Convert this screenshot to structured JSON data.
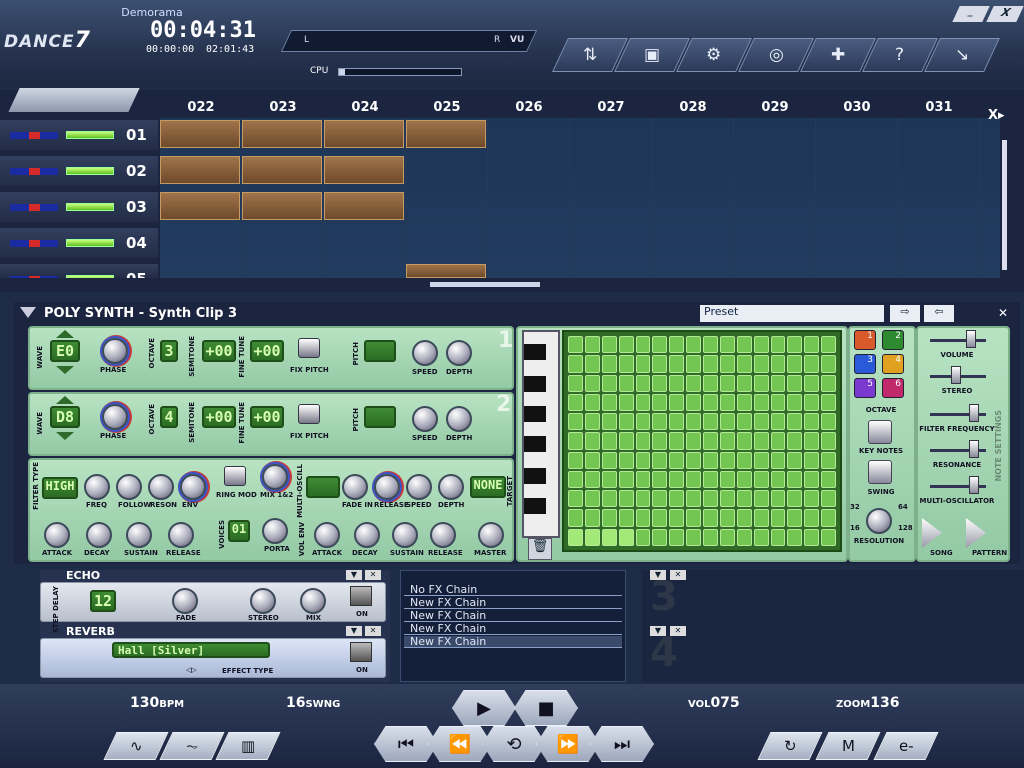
{
  "app": {
    "brand": "DANCE",
    "brand_num": "7",
    "song_name": "Demorama"
  },
  "time": {
    "main": "00:04:31",
    "elapsed": "00:00:00",
    "total": "02:01:43"
  },
  "vu": {
    "left_label": "L",
    "right_label": "R",
    "vu_label": "VU"
  },
  "cpu": {
    "label": "CPU",
    "level": 0.05
  },
  "toolbar_icons": [
    "shuffle-icon",
    "folder-icon",
    "mixer-icon",
    "record-icon",
    "puzzle-icon",
    "help-icon",
    "exit-icon"
  ],
  "toolbar_glyphs": [
    "⇅",
    "▣",
    "⚙",
    "◎",
    "✚",
    "?",
    "↘"
  ],
  "window": {
    "min": "_",
    "close": "X"
  },
  "arrangement": {
    "bars": [
      "022",
      "023",
      "024",
      "025",
      "026",
      "027",
      "028",
      "029",
      "030",
      "031"
    ],
    "tracks": [
      {
        "num": "01",
        "clips": [
          0,
          1,
          2,
          3
        ]
      },
      {
        "num": "02",
        "clips": [
          0,
          1,
          2
        ]
      },
      {
        "num": "03",
        "clips": [
          0,
          1,
          2
        ]
      },
      {
        "num": "04",
        "clips": []
      },
      {
        "num": "05",
        "clips": [
          3
        ]
      }
    ]
  },
  "synth": {
    "title": "POLY SYNTH - Synth Clip 3",
    "preset": "Preset",
    "osc1": {
      "wave": "E0",
      "octave": "3",
      "semitone": "+00",
      "fine_tune": "+00"
    },
    "osc2": {
      "wave": "D8",
      "octave": "4",
      "semitone": "+00",
      "fine_tune": "+00"
    },
    "filter": {
      "type": "HIGH"
    },
    "voices": "01",
    "multi_osc": "NONE",
    "labels": {
      "wave": "WAVE",
      "phase": "PHASE",
      "octave": "OCTAVE",
      "semitone": "SEMITONE",
      "fine_tune": "FINE TUNE",
      "fix_pitch": "FIX PITCH",
      "pitch": "PITCH",
      "speed": "SPEED",
      "depth": "DEPTH",
      "filter_type": "FILTER TYPE",
      "freq": "FREQ",
      "follow": "FOLLOW",
      "reson": "RESON",
      "env": "ENV",
      "ring_mod": "RING MOD",
      "mix12": "MIX 1&2",
      "multi_oscil": "MULTI-OSCILL",
      "fade_in": "FADE IN",
      "release": "RELEASE",
      "target": "TARGET",
      "attack": "ATTACK",
      "decay": "DECAY",
      "sustain": "SUSTAIN",
      "voices_lbl": "VOICES",
      "porta": "PORTA",
      "vol_env": "VOL ENV",
      "master": "MASTER",
      "octave_r": "OCTAVE",
      "key_notes": "KEY NOTES",
      "swing": "SWING",
      "resolution": "RESOLUTION",
      "volume": "VOLUME",
      "stereo": "STEREO",
      "filter_freq": "FILTER FREQUENCY",
      "resonance": "RESONANCE",
      "multi_osc_r": "MULTI-OSCILLATOR",
      "note_settings": "NOTE SETTINGS",
      "song": "SONG",
      "pattern": "PATTERN"
    },
    "octave_buttons": [
      "1",
      "2",
      "3",
      "4",
      "5",
      "6"
    ],
    "resolution_values": [
      "32",
      "64",
      "16",
      "128"
    ],
    "slider_levels": {
      "volume": 0.8,
      "stereo": 0.5,
      "filter_frequency": 0.85,
      "resonance": 0.85,
      "multi_oscillator": 0.85
    }
  },
  "fx": {
    "echo": {
      "title": "ECHO",
      "step_delay_label": "STEP DELAY",
      "step_delay": "12",
      "fade": "FADE",
      "stereo": "STEREO",
      "mix": "MIX",
      "on": "ON"
    },
    "reverb": {
      "title": "REVERB",
      "effect": "Hall [Silver]",
      "effect_type": "EFFECT TYPE",
      "on": "ON"
    },
    "chains": [
      "No FX Chain",
      "New FX Chain",
      "New FX Chain",
      "New FX Chain",
      "New FX Chain"
    ],
    "slot3": "3",
    "slot4": "4"
  },
  "transport": {
    "bpm": "130",
    "bpm_unit": "BPM",
    "swing": "16",
    "swing_unit": "SWNG",
    "vol_label": "VOL",
    "vol": "075",
    "zoom_label": "ZOOM",
    "zoom": "136",
    "buttons": {
      "play": "▶",
      "stop": "■",
      "rewind": "⏮",
      "back": "⏪",
      "loop": "⟲",
      "forward": "⏩",
      "end": "⏭"
    }
  }
}
